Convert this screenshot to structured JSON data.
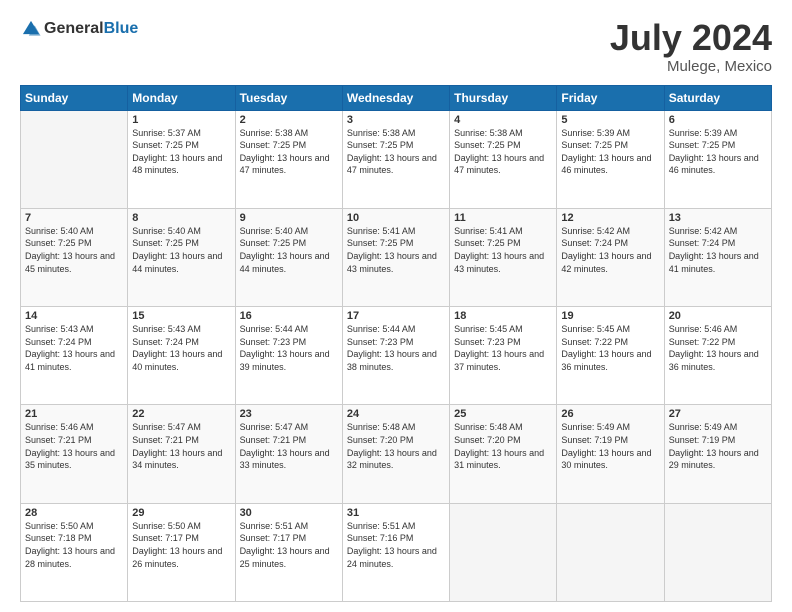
{
  "logo": {
    "general": "General",
    "blue": "Blue"
  },
  "header": {
    "month": "July 2024",
    "location": "Mulege, Mexico"
  },
  "days_of_week": [
    "Sunday",
    "Monday",
    "Tuesday",
    "Wednesday",
    "Thursday",
    "Friday",
    "Saturday"
  ],
  "weeks": [
    [
      {
        "day": "",
        "sunrise": "",
        "sunset": "",
        "daylight": ""
      },
      {
        "day": "1",
        "sunrise": "Sunrise: 5:37 AM",
        "sunset": "Sunset: 7:25 PM",
        "daylight": "Daylight: 13 hours and 48 minutes."
      },
      {
        "day": "2",
        "sunrise": "Sunrise: 5:38 AM",
        "sunset": "Sunset: 7:25 PM",
        "daylight": "Daylight: 13 hours and 47 minutes."
      },
      {
        "day": "3",
        "sunrise": "Sunrise: 5:38 AM",
        "sunset": "Sunset: 7:25 PM",
        "daylight": "Daylight: 13 hours and 47 minutes."
      },
      {
        "day": "4",
        "sunrise": "Sunrise: 5:38 AM",
        "sunset": "Sunset: 7:25 PM",
        "daylight": "Daylight: 13 hours and 47 minutes."
      },
      {
        "day": "5",
        "sunrise": "Sunrise: 5:39 AM",
        "sunset": "Sunset: 7:25 PM",
        "daylight": "Daylight: 13 hours and 46 minutes."
      },
      {
        "day": "6",
        "sunrise": "Sunrise: 5:39 AM",
        "sunset": "Sunset: 7:25 PM",
        "daylight": "Daylight: 13 hours and 46 minutes."
      }
    ],
    [
      {
        "day": "7",
        "sunrise": "Sunrise: 5:40 AM",
        "sunset": "Sunset: 7:25 PM",
        "daylight": "Daylight: 13 hours and 45 minutes."
      },
      {
        "day": "8",
        "sunrise": "Sunrise: 5:40 AM",
        "sunset": "Sunset: 7:25 PM",
        "daylight": "Daylight: 13 hours and 44 minutes."
      },
      {
        "day": "9",
        "sunrise": "Sunrise: 5:40 AM",
        "sunset": "Sunset: 7:25 PM",
        "daylight": "Daylight: 13 hours and 44 minutes."
      },
      {
        "day": "10",
        "sunrise": "Sunrise: 5:41 AM",
        "sunset": "Sunset: 7:25 PM",
        "daylight": "Daylight: 13 hours and 43 minutes."
      },
      {
        "day": "11",
        "sunrise": "Sunrise: 5:41 AM",
        "sunset": "Sunset: 7:25 PM",
        "daylight": "Daylight: 13 hours and 43 minutes."
      },
      {
        "day": "12",
        "sunrise": "Sunrise: 5:42 AM",
        "sunset": "Sunset: 7:24 PM",
        "daylight": "Daylight: 13 hours and 42 minutes."
      },
      {
        "day": "13",
        "sunrise": "Sunrise: 5:42 AM",
        "sunset": "Sunset: 7:24 PM",
        "daylight": "Daylight: 13 hours and 41 minutes."
      }
    ],
    [
      {
        "day": "14",
        "sunrise": "Sunrise: 5:43 AM",
        "sunset": "Sunset: 7:24 PM",
        "daylight": "Daylight: 13 hours and 41 minutes."
      },
      {
        "day": "15",
        "sunrise": "Sunrise: 5:43 AM",
        "sunset": "Sunset: 7:24 PM",
        "daylight": "Daylight: 13 hours and 40 minutes."
      },
      {
        "day": "16",
        "sunrise": "Sunrise: 5:44 AM",
        "sunset": "Sunset: 7:23 PM",
        "daylight": "Daylight: 13 hours and 39 minutes."
      },
      {
        "day": "17",
        "sunrise": "Sunrise: 5:44 AM",
        "sunset": "Sunset: 7:23 PM",
        "daylight": "Daylight: 13 hours and 38 minutes."
      },
      {
        "day": "18",
        "sunrise": "Sunrise: 5:45 AM",
        "sunset": "Sunset: 7:23 PM",
        "daylight": "Daylight: 13 hours and 37 minutes."
      },
      {
        "day": "19",
        "sunrise": "Sunrise: 5:45 AM",
        "sunset": "Sunset: 7:22 PM",
        "daylight": "Daylight: 13 hours and 36 minutes."
      },
      {
        "day": "20",
        "sunrise": "Sunrise: 5:46 AM",
        "sunset": "Sunset: 7:22 PM",
        "daylight": "Daylight: 13 hours and 36 minutes."
      }
    ],
    [
      {
        "day": "21",
        "sunrise": "Sunrise: 5:46 AM",
        "sunset": "Sunset: 7:21 PM",
        "daylight": "Daylight: 13 hours and 35 minutes."
      },
      {
        "day": "22",
        "sunrise": "Sunrise: 5:47 AM",
        "sunset": "Sunset: 7:21 PM",
        "daylight": "Daylight: 13 hours and 34 minutes."
      },
      {
        "day": "23",
        "sunrise": "Sunrise: 5:47 AM",
        "sunset": "Sunset: 7:21 PM",
        "daylight": "Daylight: 13 hours and 33 minutes."
      },
      {
        "day": "24",
        "sunrise": "Sunrise: 5:48 AM",
        "sunset": "Sunset: 7:20 PM",
        "daylight": "Daylight: 13 hours and 32 minutes."
      },
      {
        "day": "25",
        "sunrise": "Sunrise: 5:48 AM",
        "sunset": "Sunset: 7:20 PM",
        "daylight": "Daylight: 13 hours and 31 minutes."
      },
      {
        "day": "26",
        "sunrise": "Sunrise: 5:49 AM",
        "sunset": "Sunset: 7:19 PM",
        "daylight": "Daylight: 13 hours and 30 minutes."
      },
      {
        "day": "27",
        "sunrise": "Sunrise: 5:49 AM",
        "sunset": "Sunset: 7:19 PM",
        "daylight": "Daylight: 13 hours and 29 minutes."
      }
    ],
    [
      {
        "day": "28",
        "sunrise": "Sunrise: 5:50 AM",
        "sunset": "Sunset: 7:18 PM",
        "daylight": "Daylight: 13 hours and 28 minutes."
      },
      {
        "day": "29",
        "sunrise": "Sunrise: 5:50 AM",
        "sunset": "Sunset: 7:17 PM",
        "daylight": "Daylight: 13 hours and 26 minutes."
      },
      {
        "day": "30",
        "sunrise": "Sunrise: 5:51 AM",
        "sunset": "Sunset: 7:17 PM",
        "daylight": "Daylight: 13 hours and 25 minutes."
      },
      {
        "day": "31",
        "sunrise": "Sunrise: 5:51 AM",
        "sunset": "Sunset: 7:16 PM",
        "daylight": "Daylight: 13 hours and 24 minutes."
      },
      {
        "day": "",
        "sunrise": "",
        "sunset": "",
        "daylight": ""
      },
      {
        "day": "",
        "sunrise": "",
        "sunset": "",
        "daylight": ""
      },
      {
        "day": "",
        "sunrise": "",
        "sunset": "",
        "daylight": ""
      }
    ]
  ]
}
